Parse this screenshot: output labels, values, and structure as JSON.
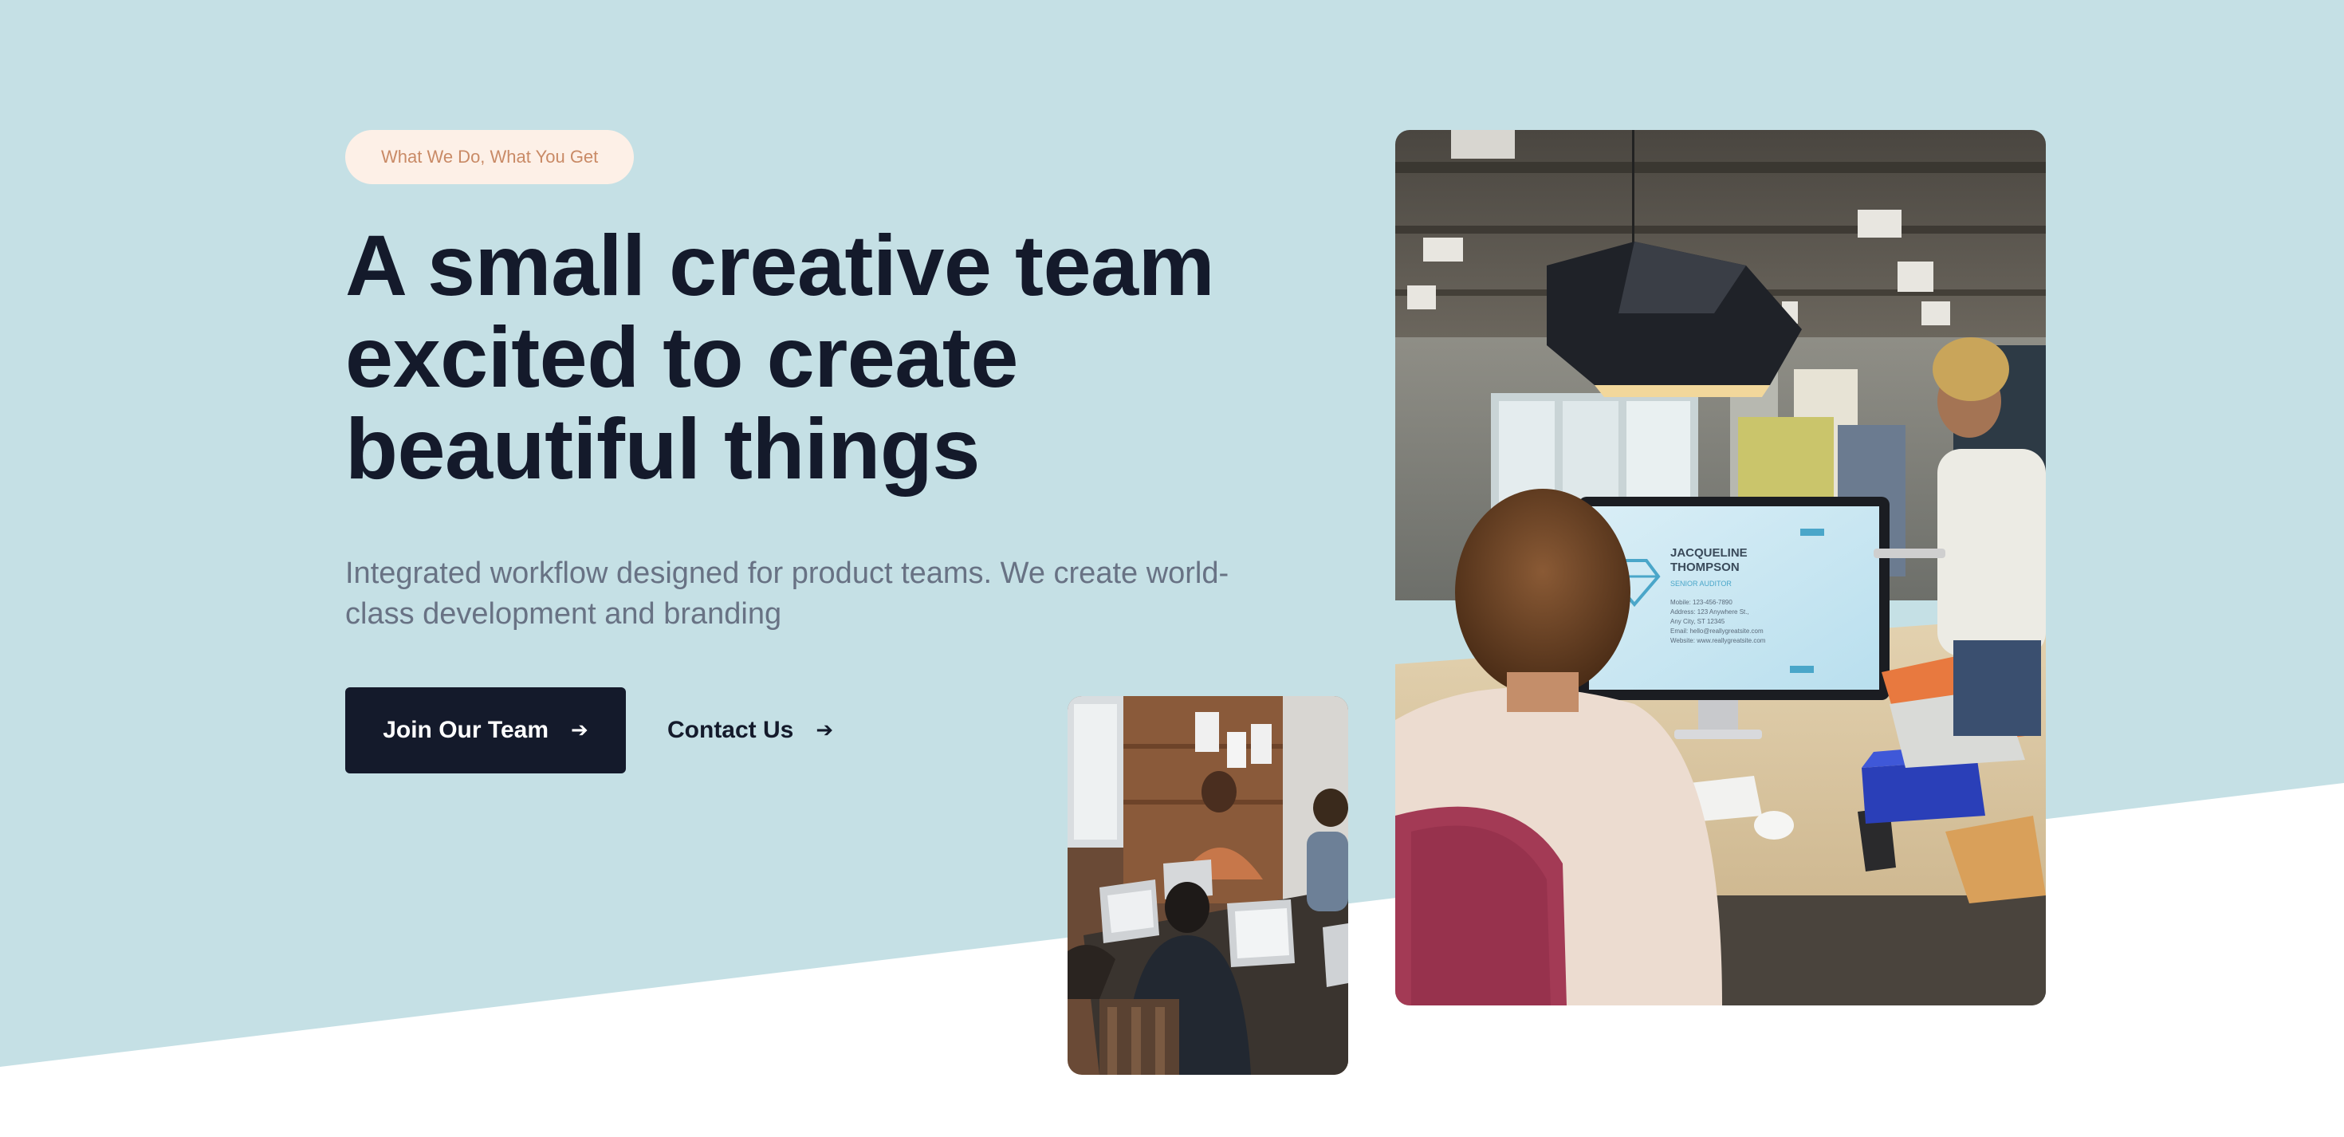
{
  "hero": {
    "eyebrow": "What We Do, What You Get",
    "headline": "A small creative team excited to create beautiful things",
    "lede": "Integrated workflow designed for product teams. We create world-class development and branding",
    "primary_cta": {
      "label": "Join Our Team",
      "icon": "arrow-right-icon"
    },
    "secondary_cta": {
      "label": "Contact Us",
      "icon": "arrow-right-icon"
    }
  },
  "photos": {
    "large": {
      "screen_name": "JACQUELINE THOMPSON",
      "screen_title": "SENIOR AUDITOR",
      "screen_details": [
        "Mobile: 123-456-7890",
        "Address: 123 Anywhere St.,",
        "Any City, ST 12345",
        "Email: hello@reallygreatsite.com",
        "Website: www.reallygreatsite.com"
      ]
    }
  },
  "colors": {
    "hero_bg": "#c5e0e5",
    "text_dark": "#141a2b",
    "text_muted": "#687284",
    "eyebrow_bg": "#fdf0e7",
    "eyebrow_text": "#c98a66"
  }
}
